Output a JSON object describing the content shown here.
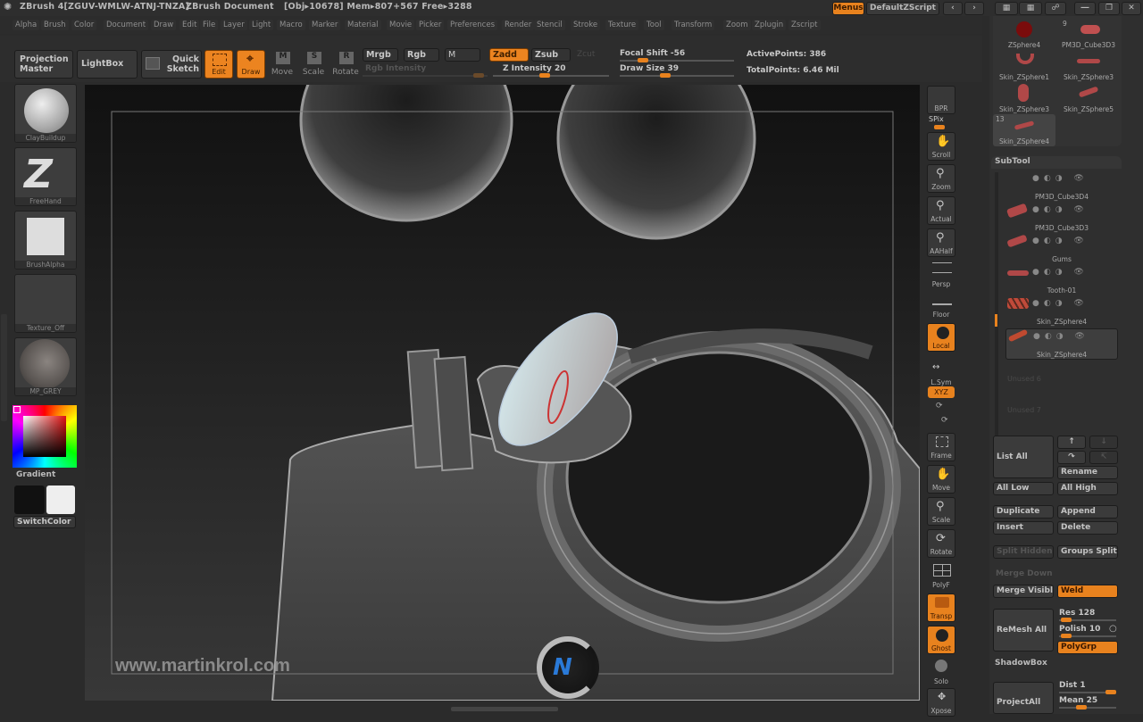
{
  "titlebar": {
    "app_title": "ZBrush 4[ZGUV-WMLW-ATNJ-TNZA]",
    "document": "ZBrush Document",
    "stats": "[Obj▸10678] Mem▸807+567 Free▸3288",
    "menus_label": "Menus",
    "script_label": "DefaultZScript"
  },
  "menubar": [
    "Alpha",
    "Brush",
    "Color",
    "Document",
    "Draw",
    "Edit",
    "File",
    "Layer",
    "Light",
    "Macro",
    "Marker",
    "Material",
    "Movie",
    "Picker",
    "Preferences",
    "Render",
    "Stencil",
    "Stroke",
    "Texture",
    "Tool",
    "Transform",
    "Zoom",
    "Zplugin",
    "Zscript"
  ],
  "shelf": {
    "projection_master": "Projection Master",
    "lightbox": "LightBox",
    "quick_sketch": "Quick Sketch",
    "edit": "Edit",
    "draw": "Draw",
    "move": "Move",
    "scale": "Scale",
    "rotate": "Rotate",
    "mrgb": "Mrgb",
    "rgb": "Rgb",
    "m": "M",
    "rgb_intensity": "Rgb Intensity",
    "zadd": "Zadd",
    "zsub": "Zsub",
    "zcut": "Zcut",
    "z_intensity": "Z Intensity 20",
    "focal_shift": "Focal Shift -56",
    "draw_size": "Draw Size 39",
    "active_points": "ActivePoints: 386",
    "total_points": "TotalPoints: 6.46 Mil",
    "z_intensity_value": 20,
    "focal_shift_value": -56,
    "draw_size_value": 39
  },
  "lefttray": {
    "brush": "ClayBuildup",
    "stroke": "FreeHand",
    "alpha": "BrushAlpha",
    "texture": "Texture_Off",
    "material": "MP_GREY",
    "gradient": "Gradient",
    "switch_color": "SwitchColor"
  },
  "righttray": {
    "bpr": "BPR",
    "spix": "SPix",
    "scroll": "Scroll",
    "zoom": "Zoom",
    "actual": "Actual",
    "aahalf": "AAHalf",
    "persp": "Persp",
    "floor": "Floor",
    "local": "Local",
    "lsym": "L.Sym",
    "xyz": "XYZ",
    "frame": "Frame",
    "move": "Move",
    "scale": "Scale",
    "rotate": "Rotate",
    "polyf": "PolyF",
    "transp": "Transp",
    "ghost": "Ghost",
    "solo": "Solo",
    "xpose": "Xpose"
  },
  "tool_thumbs": [
    {
      "name": "ZSphere4",
      "count": ""
    },
    {
      "name": "PM3D_Cube3D3",
      "count": "9"
    },
    {
      "name": "Skin_ZSphere1",
      "count": ""
    },
    {
      "name": "Skin_ZSphere3",
      "count": ""
    },
    {
      "name": "Skin_ZSphere3",
      "count": ""
    },
    {
      "name": "Skin_ZSphere5",
      "count": ""
    },
    {
      "name": "Skin_ZSphere4",
      "count": "13"
    }
  ],
  "subtool": {
    "title": "SubTool",
    "items": [
      "PM3D_Cube3D4",
      "PM3D_Cube3D3",
      "Gums",
      "Tooth-01",
      "Skin_ZSphere4",
      "Skin_ZSphere4"
    ],
    "unused": [
      "Unused 6",
      "Unused 7"
    ],
    "list_all": "List All",
    "rename": "Rename",
    "all_low": "All Low",
    "all_high": "All High",
    "duplicate": "Duplicate",
    "append": "Append",
    "insert": "Insert",
    "delete": "Delete",
    "split_hidden": "Split Hidden",
    "groups_split": "Groups Split",
    "merge_down": "Merge Down",
    "merge_visible": "Merge Visible",
    "weld": "Weld",
    "remesh_all": "ReMesh All",
    "res": "Res 128",
    "polish": "Polish 10",
    "polygrp": "PolyGrp",
    "shadowbox": "ShadowBox",
    "project_all": "ProjectAll",
    "dist": "Dist 1",
    "mean": "Mean 25"
  },
  "canvas": {
    "watermark": "www.martinkrol.com"
  },
  "colors": {
    "accent": "#e8821e",
    "panel": "#2f2f2f",
    "canvas_bg": "#111111"
  }
}
